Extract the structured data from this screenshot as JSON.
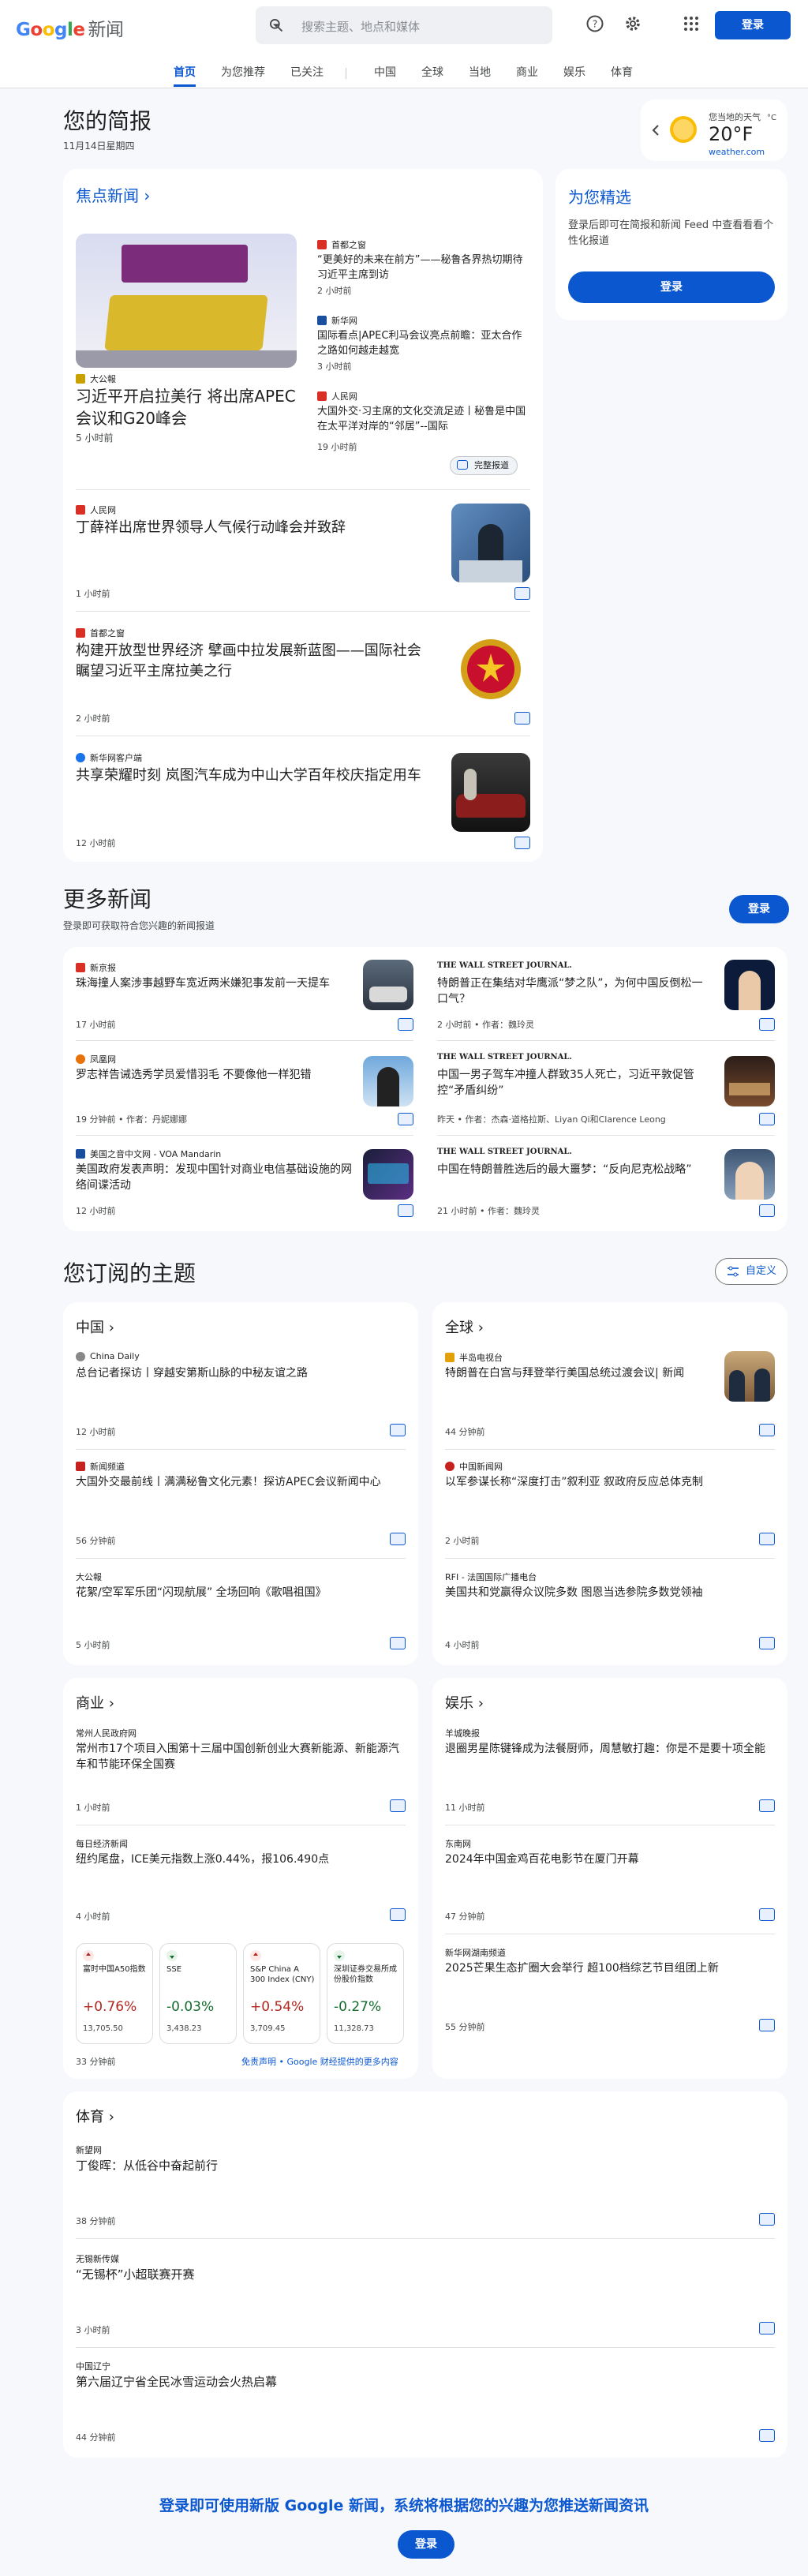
{
  "header": {
    "logo_g": "G",
    "logo_o1": "o",
    "logo_o2": "o",
    "logo_g2": "g",
    "logo_l": "l",
    "logo_e": "e",
    "logo_news": "新闻",
    "search_placeholder": "搜索主题、地点和媒体",
    "signin": "登录"
  },
  "nav": [
    "首页",
    "为您推荐",
    "已关注",
    "中国",
    "全球",
    "当地",
    "商业",
    "娱乐",
    "体育"
  ],
  "briefing": {
    "title": "您的简报",
    "date": "11月14日星期四"
  },
  "weather": {
    "label": "您当地的天气",
    "temp": "20°F",
    "unit": "°C",
    "source": "weather.com"
  },
  "top": {
    "title": "焦点新闻",
    "main": {
      "source": "大公報",
      "headline": "习近平开启拉美行 将出席APEC会议和G20峰会",
      "time": "5 小时前"
    },
    "side": [
      {
        "source": "首都之窗",
        "headline": "“更美好的未来在前方”——秘鲁各界热切期待习近平主席到访",
        "time": "2 小时前"
      },
      {
        "source": "新华网",
        "headline": "国际看点|APEC利马会议亮点前瞻：亚太合作之路如何越走越宽",
        "time": "3 小时前"
      },
      {
        "source": "人民网",
        "headline": "大国外交·习主席的文化交流足迹丨秘鲁是中国在太平洋对岸的“邻居”--国际",
        "time": "19 小时前"
      }
    ],
    "full_coverage": "完整报道",
    "items": [
      {
        "source": "人民网",
        "headline": "丁薛祥出席世界领导人气候行动峰会并致辞",
        "time": "1 小时前"
      },
      {
        "source": "首都之窗",
        "headline": "构建开放型世界经济 擘画中拉发展新蓝图——国际社会瞩望习近平主席拉美之行",
        "time": "2 小时前"
      },
      {
        "source": "新华网客户端",
        "headline": "共享荣耀时刻 岚图汽车成为中山大学百年校庆指定用车",
        "time": "12 小时前"
      }
    ]
  },
  "picks": {
    "title": "为您精选",
    "desc": "登录后即可在简报和新闻 Feed 中查看看看个性化报道",
    "button": "登录"
  },
  "more": {
    "title": "更多新闻",
    "subtitle": "登录即可获取符合您兴趣的新闻报道",
    "button": "登录",
    "items": [
      {
        "source": "新京报",
        "headline": "珠海撞人案涉事越野车宽近两米嫌犯事发前一天提车",
        "time": "17 小时前"
      },
      {
        "source": "THE WALL STREET JOURNAL.",
        "headline": "特朗普正在集结对华鹰派“梦之队”，为何中国反倒松一口气？",
        "time": "2 小时前 • 作者：魏玲灵"
      },
      {
        "source": "凤凰网",
        "headline": "罗志祥告诫选秀学员爱惜羽毛 不要像他一样犯错",
        "time": "19 分钟前 • 作者：丹妮娜娜"
      },
      {
        "source": "THE WALL STREET JOURNAL.",
        "headline": "中国一男子驾车冲撞人群致35人死亡，习近平敦促管控“矛盾纠纷”",
        "time": "昨天 • 作者：杰森·道格拉斯、Liyan Qi和Clarence Leong"
      },
      {
        "source": "美国之音中文网 - VOA Mandarin",
        "headline": "美国政府发表声明：发现中国针对商业电信基础设施的网络间谍活动",
        "time": "12 小时前"
      },
      {
        "source": "THE WALL STREET JOURNAL.",
        "headline": "中国在特朗普胜选后的最大噩梦：“反向尼克松战略”",
        "time": "21 小时前 • 作者：魏玲灵"
      }
    ]
  },
  "topics": {
    "title": "您订阅的主题",
    "customize": "自定义",
    "china": {
      "title": "中国",
      "items": [
        {
          "source": "China Daily",
          "headline": "总台记者探访丨穿越安第斯山脉的中秘友谊之路",
          "time": "12 小时前"
        },
        {
          "source": "新闻频道",
          "headline": "大国外交最前线丨满满秘鲁文化元素！探访APEC会议新闻中心",
          "time": "56 分钟前"
        },
        {
          "source": "大公報",
          "headline": "花絮/空军军乐团“闪现航展” 全场回响《歌唱祖国》",
          "time": "5 小时前"
        }
      ]
    },
    "world": {
      "title": "全球",
      "items": [
        {
          "source": "半岛电视台",
          "headline": "特朗普在白宫与拜登举行美国总统过渡会议| 新闻",
          "time": "44 分钟前"
        },
        {
          "source": "中国新闻网",
          "headline": "以军参谋长称“深度打击”叙利亚 叙政府反应总体克制",
          "time": "2 小时前"
        },
        {
          "source": "RFI - 法国国际广播电台",
          "headline": "美国共和党赢得众议院多数 图恩当选参院多数党领袖",
          "time": "4 小时前"
        }
      ]
    },
    "business": {
      "title": "商业",
      "items": [
        {
          "source": "常州人民政府网",
          "headline": "常州市17个项目入围第十三届中国创新创业大赛新能源、新能源汽车和节能环保全国赛",
          "time": "1 小时前"
        },
        {
          "source": "每日经济新闻",
          "headline": "纽约尾盘，ICE美元指数上涨0.44%，报106.490点",
          "time": "4 小时前"
        }
      ],
      "stocks": [
        {
          "name": "富时中国A50指数",
          "change": "+0.76%",
          "value": "13,705.50",
          "up": true
        },
        {
          "name": "SSE",
          "change": "-0.03%",
          "value": "3,438.23",
          "up": false
        },
        {
          "name": "S&P China A 300 Index (CNY)",
          "change": "+0.54%",
          "value": "3,709.45",
          "up": true
        },
        {
          "name": "深圳证券交易所成份股价指数",
          "change": "-0.27%",
          "value": "11,328.73",
          "up": false
        }
      ],
      "time": "33 分钟前",
      "disclaimer": "免责声明 • Google 财经提供的更多内容"
    },
    "entertainment": {
      "title": "娱乐",
      "items": [
        {
          "source": "羊城晚报",
          "headline": "退圈男星陈键锋成为法餐厨师，周慧敏打趣：你是不是要十项全能",
          "time": "11 小时前"
        },
        {
          "source": "东南网",
          "headline": "2024年中国金鸡百花电影节在厦门开幕",
          "time": "47 分钟前"
        },
        {
          "source": "新华网湖南频道",
          "headline": "2025芒果生态扩圈大会举行 超100档综艺节目组团上新",
          "time": "55 分钟前"
        }
      ]
    },
    "sports": {
      "title": "体育",
      "items": [
        {
          "source": "新望网",
          "headline": "丁俊晖：从低谷中奋起前行",
          "time": "38 分钟前"
        },
        {
          "source": "无锡新传媒",
          "headline": "“无锡杯”小超联赛开赛",
          "time": "3 小时前"
        },
        {
          "source": "中国辽宁",
          "headline": "第六届辽宁省全民冰雪运动会火热启幕",
          "time": "44 分钟前"
        }
      ]
    }
  },
  "footer": {
    "text": "登录即可使用新版 Google 新闻，系统将根据您的兴趣为您推送新闻资讯",
    "button": "登录"
  },
  "colors": {
    "accent": "#0b57d0",
    "up": "#b3261e",
    "down": "#146c2e"
  }
}
